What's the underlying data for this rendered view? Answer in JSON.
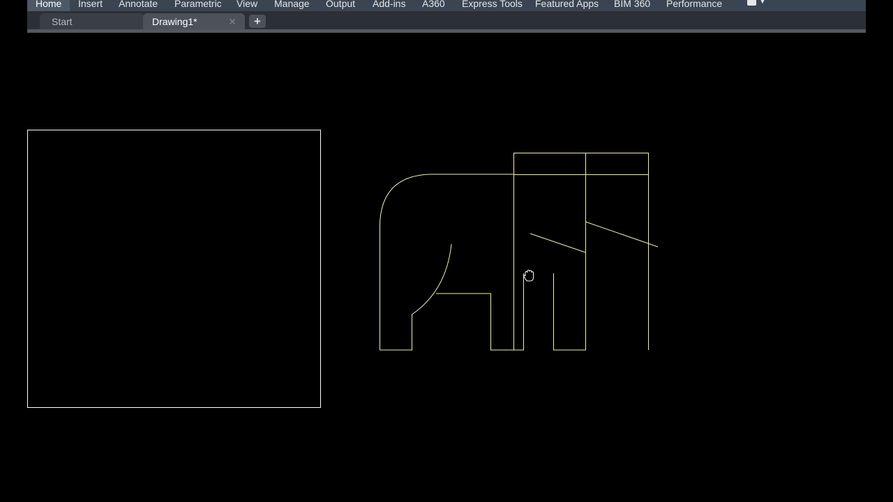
{
  "ribbon": {
    "tabs": [
      {
        "label": "Home",
        "active": true
      },
      {
        "label": "Insert"
      },
      {
        "label": "Annotate"
      },
      {
        "label": "Parametric"
      },
      {
        "label": "View"
      },
      {
        "label": "Manage"
      },
      {
        "label": "Output"
      },
      {
        "label": "Add-ins"
      },
      {
        "label": "A360"
      },
      {
        "label": "Express Tools"
      },
      {
        "label": "Featured Apps"
      },
      {
        "label": "BIM 360"
      },
      {
        "label": "Performance"
      }
    ],
    "dropdown_icon": "workspace-toggle-icon",
    "colors": {
      "background": "#3b4453",
      "active": "#4d5868"
    }
  },
  "file_tabs": {
    "tabs": [
      {
        "label": "Start"
      },
      {
        "label": "Drawing1*",
        "active": true,
        "close_glyph": "✕"
      }
    ],
    "new_tab_glyph": "+"
  },
  "drawing": {
    "background": "#000000",
    "line_color_white": "#ffffff",
    "line_color_yellow": "#f2f0b0",
    "cursor_icon": "pan-hand-icon"
  }
}
